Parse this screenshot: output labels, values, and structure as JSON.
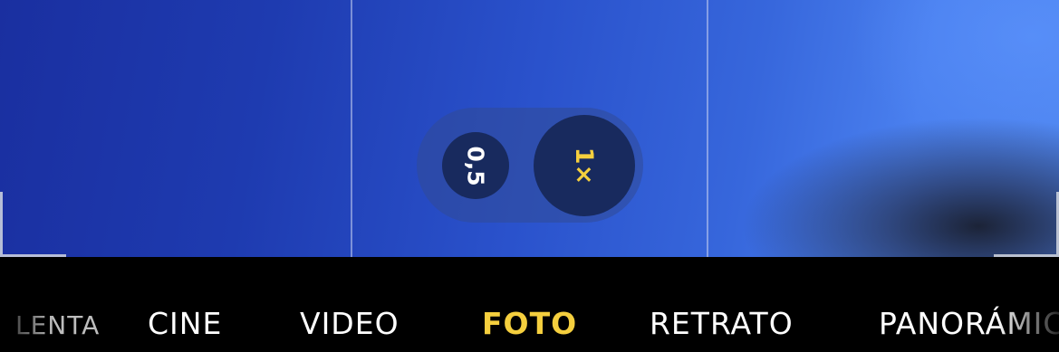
{
  "camera": {
    "zoom": {
      "options": [
        {
          "label": "0,5",
          "selected": false
        },
        {
          "label": "1×",
          "selected": true
        }
      ],
      "active_color": "#f5cf3e",
      "inactive_color": "#ffffff"
    },
    "modes": [
      {
        "label": "LENTA",
        "selected": false
      },
      {
        "label": "CINE",
        "selected": false
      },
      {
        "label": "VIDEO",
        "selected": false
      },
      {
        "label": "FOTO",
        "selected": true
      },
      {
        "label": "RETRATO",
        "selected": false
      },
      {
        "label": "PANORÁMICO",
        "selected": false
      }
    ],
    "colors": {
      "accent": "#f5cf3e",
      "mode_bar_background": "#000000"
    }
  }
}
